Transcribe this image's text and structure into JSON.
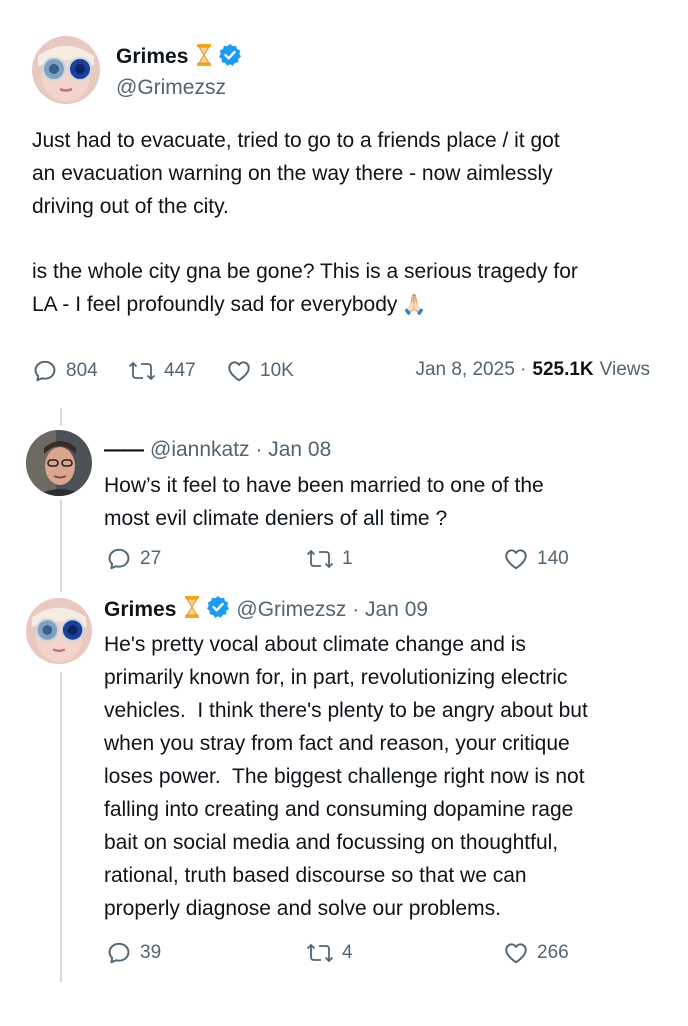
{
  "main_tweet": {
    "author_name": "Grimes",
    "handle": "@Grimezsz",
    "hourglass_icon": "⌛",
    "paragraph_1": "Just had to evacuate, tried to go to a friends place / it got\nan evacuation warning on the way there - now aimlessly\ndriving out of the city.",
    "paragraph_2": "is the whole city gna be gone? This is a serious tragedy for\nLA - I feel profoundly sad for everybody",
    "emoji": "🙏🏻",
    "replies": "804",
    "reposts": "447",
    "likes": "10K",
    "date": "Jan 8, 2025 ·",
    "views_count": "525.1K",
    "views_label": "Views"
  },
  "reply_1": {
    "dash": "——",
    "handle_date": "@iannkatz · Jan 08",
    "text": "How’s it feel to have been married to one of the\nmost evil climate deniers of all time ?",
    "replies": "27",
    "reposts": "1",
    "likes": "140"
  },
  "reply_2": {
    "author_name": "Grimes",
    "hourglass_icon": "⌛",
    "handle_date": "@Grimezsz · Jan 09",
    "text": "He's pretty vocal about climate change and is\nprimarily known for, in part, revolutionizing electric\nvehicles.  I think there's plenty to be angry about but\nwhen you stray from fact and reason, your critique\nloses power.  The biggest challenge right now is not\nfalling into creating and consuming dopamine rage\nbait on social media and focussing on thoughtful,\nrational, truth based discourse so that we can\nproperly diagnose and solve our problems.",
    "replies": "39",
    "reposts": "4",
    "likes": "266"
  },
  "colors": {
    "text": "#0f1419",
    "muted": "#536471",
    "verified": "#1d9bf0",
    "hourglass": "#f4a623",
    "thread_line": "#cfd9de"
  },
  "icons": [
    "reply-icon",
    "repost-icon",
    "like-icon",
    "verified-badge-icon",
    "hourglass-icon"
  ]
}
